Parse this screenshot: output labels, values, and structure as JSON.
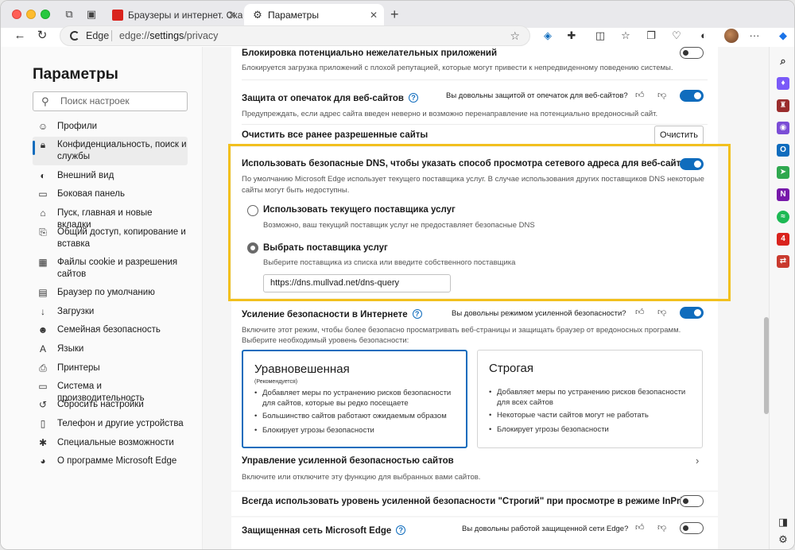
{
  "tabs": [
    {
      "label": "Браузеры и интернет. Скача",
      "active": false
    },
    {
      "label": "Параметры",
      "active": true
    }
  ],
  "address": {
    "label": "Edge",
    "url_prefix": "edge://",
    "url_bold": "settings",
    "url_suffix": "/privacy"
  },
  "colors": {
    "accent": "#0f6cbd",
    "highlight": "#f2c01e"
  },
  "sidebar": {
    "title": "Параметры",
    "search_placeholder": "Поиск настроек",
    "items": [
      {
        "label": "Профили",
        "icon": "profile-icon"
      },
      {
        "label": "Конфиденциальность, поиск и службы",
        "icon": "lock-icon",
        "selected": true
      },
      {
        "label": "Внешний вид",
        "icon": "appearance-icon"
      },
      {
        "label": "Боковая панель",
        "icon": "sidebar-panel-icon"
      },
      {
        "label": "Пуск, главная и новые вкладки",
        "icon": "home-icon"
      },
      {
        "label": "Общий доступ, копирование и вставка",
        "icon": "share-icon"
      },
      {
        "label": "Файлы cookie и разрешения сайтов",
        "icon": "cookie-icon"
      },
      {
        "label": "Браузер по умолчанию",
        "icon": "default-browser-icon"
      },
      {
        "label": "Загрузки",
        "icon": "download-icon"
      },
      {
        "label": "Семейная безопасность",
        "icon": "family-icon"
      },
      {
        "label": "Языки",
        "icon": "language-icon"
      },
      {
        "label": "Принтеры",
        "icon": "printer-icon"
      },
      {
        "label": "Система и производительность",
        "icon": "system-icon"
      },
      {
        "label": "Сбросить настройки",
        "icon": "reset-icon"
      },
      {
        "label": "Телефон и другие устройства",
        "icon": "phone-icon"
      },
      {
        "label": "Специальные возможности",
        "icon": "accessibility-icon"
      },
      {
        "label": "О программе Microsoft Edge",
        "icon": "edge-logo-icon"
      }
    ]
  },
  "main": {
    "pua": {
      "title": "Блокировка потенциально нежелательных приложений",
      "desc": "Блокируется загрузка приложений с плохой репутацией, которые могут привести к непредвиденному поведению системы.",
      "enabled": false
    },
    "typo": {
      "title": "Защита от опечаток для веб-сайтов",
      "question": "Вы довольны защитой от опечаток для веб-сайтов?",
      "desc": "Предупреждать, если адрес сайта введен неверно и возможно перенаправление на потенциально вредоносный сайт.",
      "enabled": true
    },
    "clear": {
      "title": "Очистить все ранее разрешенные сайты",
      "button": "Очистить"
    },
    "dns": {
      "title": "Использовать безопасные DNS, чтобы указать способ просмотра сетевого адреса для веб-сайтов",
      "desc": "По умолчанию Microsoft Edge использует текущего поставщика услуг. В случае использования других поставщиков DNS некоторые сайты могут быть недоступны.",
      "enabled": true,
      "option1": {
        "label": "Использовать текущего поставщика услуг",
        "desc": "Возможно, ваш текущий поставщик услуг не предоставляет безопасные DNS"
      },
      "option2": {
        "label": "Выбрать поставщика услуг",
        "desc": "Выберите поставщика из списка или введите собственного поставщика"
      },
      "provider_value": "https://dns.mullvad.net/dns-query"
    },
    "enhanced": {
      "title": "Усиление безопасности в Интернете",
      "question": "Вы довольны режимом усиленной безопасности?",
      "desc1": "Включите этот режим, чтобы более безопасно просматривать веб-страницы и защищать браузер от вредоносных программ.",
      "desc2": "Выберите необходимый уровень безопасности:",
      "enabled": true,
      "balanced": {
        "title": "Уравновешенная",
        "subtitle": "(Рекомендуется)",
        "points": [
          "Добавляет меры по устранению рисков безопасности для сайтов, которые вы редко посещаете",
          "Большинство сайтов работают ожидаемым образом",
          "Блокирует угрозы безопасности"
        ]
      },
      "strict": {
        "title": "Строгая",
        "points": [
          "Добавляет меры по устранению рисков безопасности для всех сайтов",
          "Некоторые части сайтов могут не работать",
          "Блокирует угрозы безопасности"
        ]
      }
    },
    "manage": {
      "title": "Управление усиленной безопасностью сайтов",
      "desc": "Включите или отключите эту функцию для выбранных вами сайтов."
    },
    "inprivate": {
      "title": "Всегда использовать уровень усиленной безопасности \"Строгий\" при просмотре в режиме InPrivate",
      "enabled": false
    },
    "secure_network": {
      "title": "Защищенная сеть Microsoft Edge",
      "question": "Вы довольны работой защищенной сети Edge?",
      "enabled": false
    }
  }
}
